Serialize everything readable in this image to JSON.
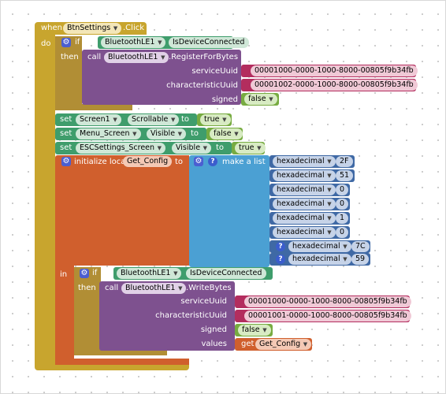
{
  "event": {
    "when": "when",
    "component": "BtnSettings",
    "event": ".Click",
    "do": "do"
  },
  "if1": {
    "if": "if",
    "component": "BluetoothLE1",
    "property": "IsDeviceConnected",
    "then": "then",
    "call": "call",
    "method": ".RegisterForBytes",
    "service_label": "serviceUuid",
    "service_value": "00001000-0000-1000-8000-00805f9b34fb",
    "char_label": "characteristicUuid",
    "char_value": "00001002-0000-1000-8000-00805f9b34fb",
    "signed_label": "signed",
    "signed_value": "false"
  },
  "sets": [
    {
      "set": "set",
      "component": "Screen1",
      "property": "Scrollable",
      "to": "to",
      "value": "true"
    },
    {
      "set": "set",
      "component": "Menu_Screen",
      "property": "Visible",
      "to": "to",
      "value": "false"
    },
    {
      "set": "set",
      "component": "ESCSettings_Screen",
      "property": "Visible",
      "to": "to",
      "value": "true"
    }
  ],
  "local": {
    "label": "initialize local",
    "name": "Get_Config",
    "to": "to",
    "in": "in"
  },
  "list": {
    "label": "make a list",
    "items": [
      {
        "type": "hexadecimal",
        "value": "2F"
      },
      {
        "type": "hexadecimal",
        "value": "51"
      },
      {
        "type": "hexadecimal",
        "value": "0"
      },
      {
        "type": "hexadecimal",
        "value": "0"
      },
      {
        "type": "hexadecimal",
        "value": "1"
      },
      {
        "type": "hexadecimal",
        "value": "0"
      },
      {
        "type": "hexadecimal",
        "value": "7C"
      },
      {
        "type": "hexadecimal",
        "value": "59"
      }
    ]
  },
  "if2": {
    "if": "if",
    "component": "BluetoothLE1",
    "property": "IsDeviceConnected",
    "then": "then",
    "call": "call",
    "method": ".WriteBytes",
    "service_label": "serviceUuid",
    "service_value": "00001000-0000-1000-8000-00805f9b34fb",
    "char_label": "characteristicUuid",
    "char_value": "00001001-0000-1000-8000-00805f9b34fb",
    "signed_label": "signed",
    "signed_value": "false",
    "values_label": "values",
    "get": "get",
    "get_var": "Get_Config"
  },
  "colors": {
    "event": "#c8a52e",
    "control": "#b18e35",
    "ble": "#3f9d6c",
    "method": "#7e518f",
    "text": "#b32d5e",
    "logic": "#77ab41",
    "var": "#d05f2d",
    "list": "#4ba0d3",
    "math": "#3f69a5"
  }
}
